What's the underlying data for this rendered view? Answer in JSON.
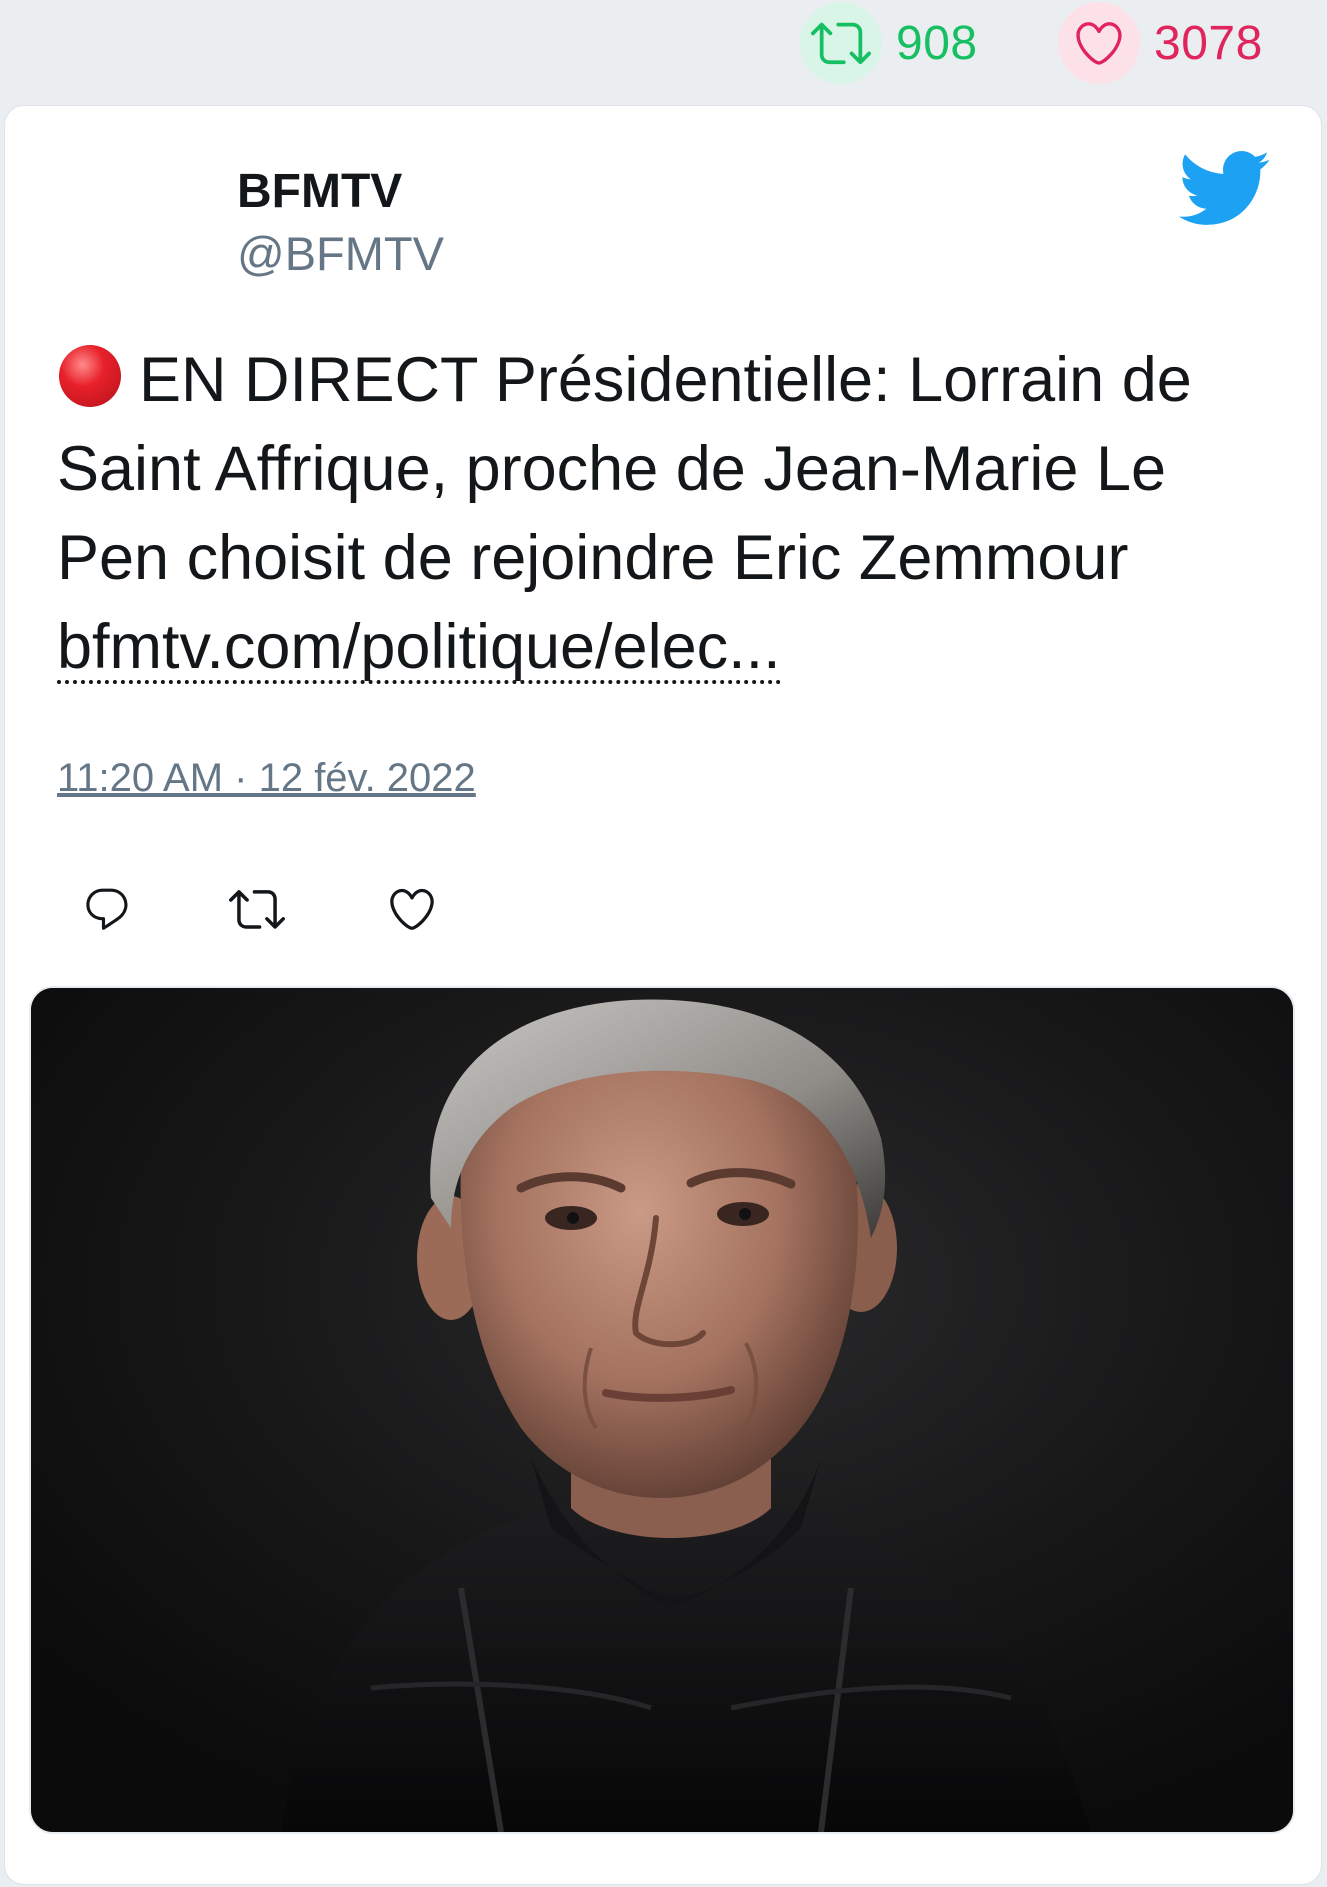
{
  "engagement": {
    "retweet_count": "908",
    "like_count": "3078",
    "retweet_icon": "retweet-icon",
    "like_icon": "heart-icon",
    "retweet_color": "#17bf63",
    "like_color": "#e0245e"
  },
  "tweet": {
    "author_name": "BFMTV",
    "author_handle": "@BFMTV",
    "live_icon": "red-circle-emoji",
    "text": "EN DIRECT Présidentielle: Lorrain de Saint Affrique, proche de Jean-Marie Le Pen choisit de rejoindre Eric Zemmour",
    "link_text": "bfmtv.com/politique/elec...",
    "timestamp": "11:20 AM · 12 fév. 2022",
    "brand_icon": "twitter-bird-icon",
    "brand_color": "#1da1f2"
  },
  "actions": [
    {
      "icon": "reply-icon"
    },
    {
      "icon": "retweet-icon"
    },
    {
      "icon": "heart-icon"
    }
  ],
  "media": {
    "kind": "photo",
    "subject": "portrait of a grey-haired man in a black jacket on dark background"
  }
}
